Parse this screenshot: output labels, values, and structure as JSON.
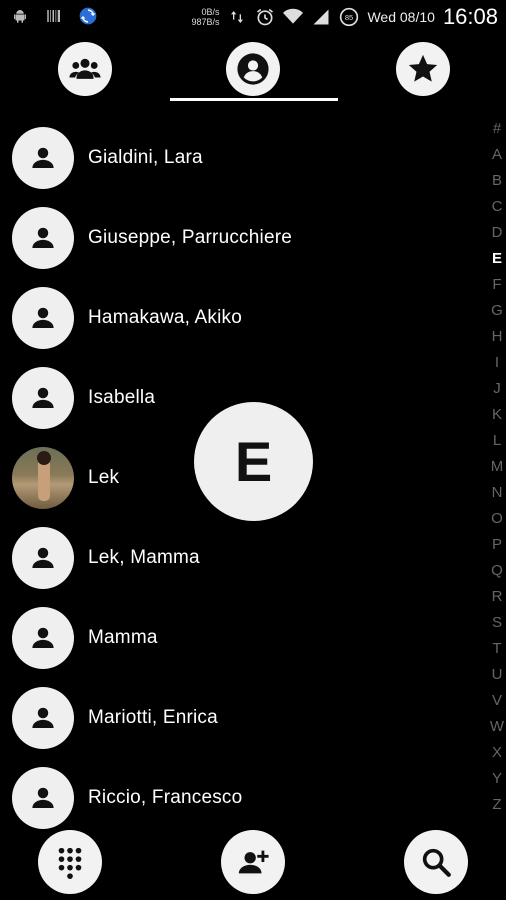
{
  "status_bar": {
    "net_up": "0B/s",
    "net_down": "987B/s",
    "battery": "85",
    "date": "Wed 08/10",
    "time": "16:08",
    "icons": [
      "android-icon",
      "barcode-icon",
      "sync-icon",
      "data-arrows-icon",
      "alarm-icon",
      "wifi-icon",
      "signal-icon",
      "battery-icon"
    ]
  },
  "tabs": [
    {
      "name": "groups",
      "icon": "groups-icon"
    },
    {
      "name": "contacts",
      "icon": "person-icon",
      "selected": true
    },
    {
      "name": "favorites",
      "icon": "star-icon"
    }
  ],
  "contacts": [
    {
      "name": "Gialdini, Lara",
      "avatar": "default"
    },
    {
      "name": "Giuseppe, Parrucchiere",
      "avatar": "default"
    },
    {
      "name": "Hamakawa, Akiko",
      "avatar": "default"
    },
    {
      "name": "Isabella",
      "avatar": "default"
    },
    {
      "name": "Lek",
      "avatar": "photo"
    },
    {
      "name": "Lek, Mamma",
      "avatar": "default"
    },
    {
      "name": "Mamma",
      "avatar": "default"
    },
    {
      "name": "Mariotti, Enrica",
      "avatar": "default"
    },
    {
      "name": "Riccio, Francesco",
      "avatar": "default"
    }
  ],
  "index_letters": [
    "#",
    "A",
    "B",
    "C",
    "D",
    "E",
    "F",
    "G",
    "H",
    "I",
    "J",
    "K",
    "L",
    "M",
    "N",
    "O",
    "P",
    "Q",
    "R",
    "S",
    "T",
    "U",
    "V",
    "W",
    "X",
    "Y",
    "Z"
  ],
  "active_letter": "E",
  "bubble_letter": "E",
  "bottom_actions": [
    {
      "name": "dialpad",
      "icon": "dialpad-icon"
    },
    {
      "name": "add-contact",
      "icon": "add-person-icon"
    },
    {
      "name": "search",
      "icon": "search-icon"
    }
  ]
}
